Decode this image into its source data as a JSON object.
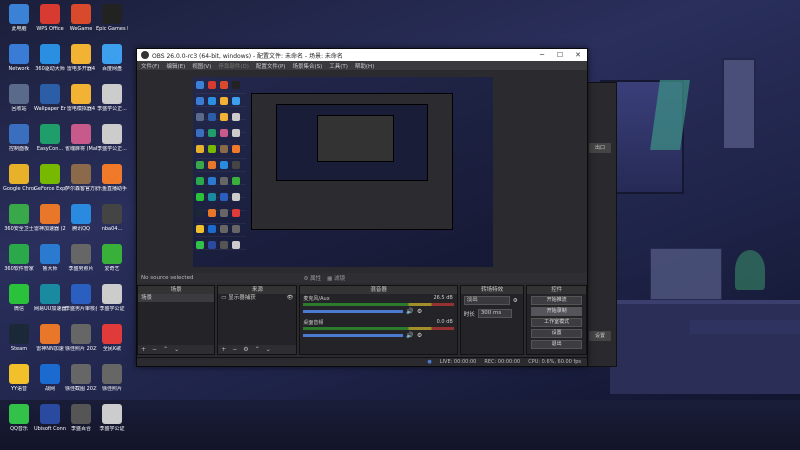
{
  "desktop": {
    "icons": [
      {
        "label": "此电脑",
        "color": "#3b82d6"
      },
      {
        "label": "WPS Office",
        "color": "#d73a31"
      },
      {
        "label": "WeGame",
        "color": "#d94a2c"
      },
      {
        "label": "Epic Games Launcher",
        "color": "#222222"
      },
      {
        "label": "Network",
        "color": "#3a7bd5"
      },
      {
        "label": "360驱动大师",
        "color": "#2a8fe0"
      },
      {
        "label": "雷电多开器4",
        "color": "#f2b233"
      },
      {
        "label": "百度网盘",
        "color": "#3ca0ef"
      },
      {
        "label": "回收站",
        "color": "#5a6a8a"
      },
      {
        "label": "Wallpaper Engine:...",
        "color": "#2c5ea8"
      },
      {
        "label": "雷电模拟器4",
        "color": "#f2b233"
      },
      {
        "label": "李盛学公正...",
        "color": "#cccccc"
      },
      {
        "label": "控制面板",
        "color": "#3a6fbf"
      },
      {
        "label": "EasyCon...",
        "color": "#1f9e6b"
      },
      {
        "label": "雀魂麻将 (Mahjong...",
        "color": "#c75a8a"
      },
      {
        "label": "李盛学公正...",
        "color": "#cccccc"
      },
      {
        "label": "Google Chrome",
        "color": "#e8b12a"
      },
      {
        "label": "GeForce Experience",
        "color": "#76b900"
      },
      {
        "label": "萨尔森客官方服务器",
        "color": "#8a6a4a"
      },
      {
        "label": "乐鱼直播助手",
        "color": "#f07a2a"
      },
      {
        "label": "360安全卫士",
        "color": "#38a84a"
      },
      {
        "label": "雷神加速器 (2)",
        "color": "#e8772a"
      },
      {
        "label": "腾讯QQ",
        "color": "#2a8ae0"
      },
      {
        "label": "nba04...",
        "color": "#444444"
      },
      {
        "label": "360软件管家",
        "color": "#2aa84a"
      },
      {
        "label": "鲁大师",
        "color": "#2a7ad0"
      },
      {
        "label": "李盛男照片",
        "color": "#666666"
      },
      {
        "label": "爱奇艺",
        "color": "#38b03a"
      },
      {
        "label": "微信",
        "color": "#2ac23a"
      },
      {
        "label": "网易UU加速器",
        "color": "#1a8aa0"
      },
      {
        "label": "李盛男片审核台推工具",
        "color": "#2a5fbf"
      },
      {
        "label": "李盛学公证",
        "color": "#cccccc"
      },
      {
        "label": "Steam",
        "color": "#1b2838"
      },
      {
        "label": "雷神NN加速",
        "color": "#e8772a"
      },
      {
        "label": "徐佳照片 2021/12...",
        "color": "#666666"
      },
      {
        "label": "全民K歌",
        "color": "#e03a3a"
      },
      {
        "label": "YY语音",
        "color": "#f2c02a"
      },
      {
        "label": "战网",
        "color": "#1a6ad0"
      },
      {
        "label": "徐佳截图 2021/12...",
        "color": "#666666"
      },
      {
        "label": "徐佳照片",
        "color": "#666666"
      },
      {
        "label": "QQ音乐",
        "color": "#32c24a"
      },
      {
        "label": "Ubisoft Connect",
        "color": "#2a4aa0"
      },
      {
        "label": "李盛百合",
        "color": "#555555"
      },
      {
        "label": "李盛学公证",
        "color": "#cccccc"
      }
    ]
  },
  "bg_app": {
    "btn1": "出口",
    "btn2": "设置"
  },
  "obs": {
    "title": "OBS 26.0.0-rc3 (64-bit, windows) - 配置文件: 未命名 - 场景: 未命名",
    "menu": [
      "文件(F)",
      "编辑(E)",
      "视图(V)",
      "停靠部件(D)",
      "配置文件(P)",
      "场景集合(S)",
      "工具(T)",
      "帮助(H)"
    ],
    "status_no_source": "No source selected",
    "toolbar_props": "属性",
    "toolbar_filters": "滤镜",
    "docks": {
      "scenes": {
        "title": "场景",
        "items": [
          "场景"
        ]
      },
      "sources": {
        "title": "来源",
        "items": [
          "显示器捕获"
        ]
      },
      "mixer": {
        "title": "混音器",
        "channels": [
          {
            "name": "麦克风/Aux",
            "value": "26.5 dB"
          },
          {
            "name": "桌面音频",
            "value": "0.0 dB"
          }
        ]
      },
      "transitions": {
        "title": "转场特效",
        "type": "淡出",
        "duration_label": "时长",
        "duration": "300 ms"
      },
      "controls": {
        "title": "控件",
        "buttons": [
          "开始推流",
          "开始录制",
          "工作室模式",
          "设置",
          "退出"
        ]
      }
    },
    "statusbar": {
      "live": "LIVE: 00:00:00",
      "rec": "REC: 00:00:00",
      "cpu": "CPU: 0.6%, 60.00 fps"
    }
  }
}
